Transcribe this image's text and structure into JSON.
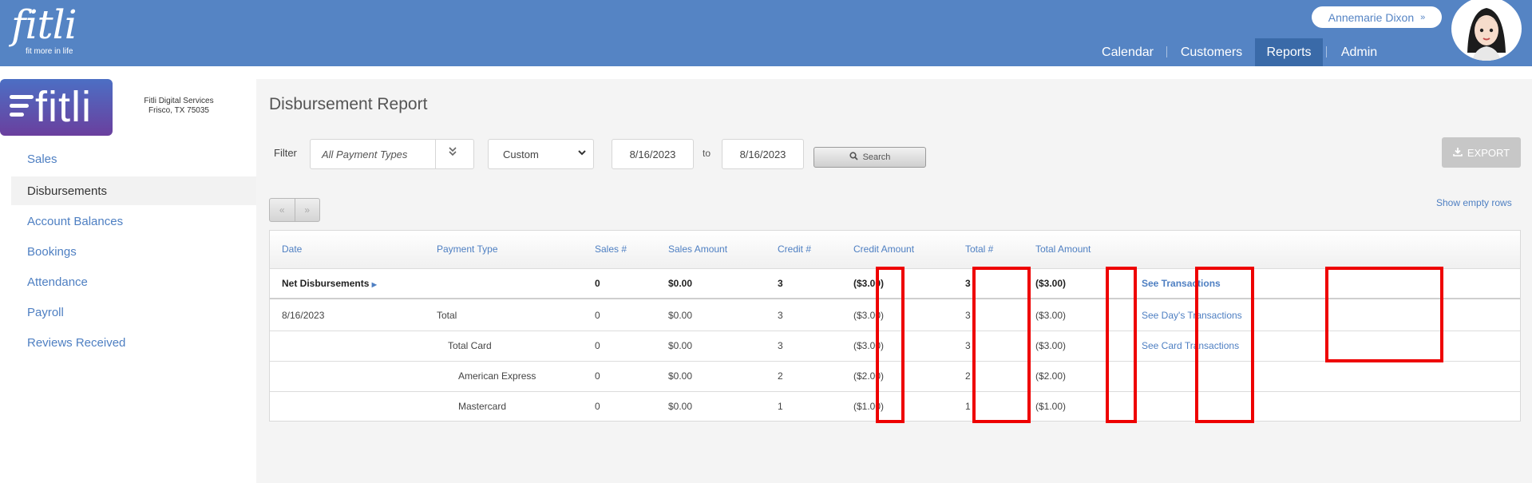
{
  "brand": {
    "name": "fitli",
    "tagline": "fit more in life"
  },
  "user": {
    "name": "Annemarie Dixon",
    "chevron": "»"
  },
  "nav": [
    {
      "label": "Calendar",
      "active": false
    },
    {
      "label": "Customers",
      "active": false
    },
    {
      "label": "Reports",
      "active": true
    },
    {
      "label": "Admin",
      "active": false
    }
  ],
  "company": {
    "logo_text": "fitli",
    "name": "Fitli Digital Services",
    "address": "Frisco, TX 75035"
  },
  "sidebar": {
    "items": [
      {
        "label": "Sales",
        "active": false
      },
      {
        "label": "Disbursements",
        "active": true
      },
      {
        "label": "Account Balances",
        "active": false
      },
      {
        "label": "Bookings",
        "active": false
      },
      {
        "label": "Attendance",
        "active": false
      },
      {
        "label": "Payroll",
        "active": false
      },
      {
        "label": "Reviews Received",
        "active": false
      }
    ]
  },
  "report": {
    "title": "Disbursement Report",
    "filter_label": "Filter",
    "payment_type_placeholder": "All Payment Types",
    "range_value": "Custom",
    "date_from": "8/16/2023",
    "to_label": "to",
    "date_to": "8/16/2023",
    "search_label": "Search",
    "export_label": "EXPORT",
    "pager_prev": "«",
    "pager_next": "»",
    "show_empty_rows": "Show empty rows"
  },
  "table": {
    "headers": [
      "Date",
      "Payment Type",
      "Sales #",
      "Sales Amount",
      "Credit #",
      "Credit Amount",
      "Total #",
      "Total Amount"
    ],
    "rows": [
      {
        "label": "Net Disbursements",
        "date": "",
        "type": "",
        "sales_n": "0",
        "sales_amt": "$0.00",
        "credit_n": "3",
        "credit_amt": "($3.00)",
        "total_n": "3",
        "total_amt": "($3.00)",
        "link": "See Transactions"
      },
      {
        "label": "",
        "date": "8/16/2023",
        "type": "Total",
        "sales_n": "0",
        "sales_amt": "$0.00",
        "credit_n": "3",
        "credit_amt": "($3.00)",
        "total_n": "3",
        "total_amt": "($3.00)",
        "link": "See Day's Transactions"
      },
      {
        "label": "",
        "date": "",
        "type": "Total Card",
        "sales_n": "0",
        "sales_amt": "$0.00",
        "credit_n": "3",
        "credit_amt": "($3.00)",
        "total_n": "3",
        "total_amt": "($3.00)",
        "link": "See Card Transactions"
      },
      {
        "label": "",
        "date": "",
        "type": "American Express",
        "sales_n": "0",
        "sales_amt": "$0.00",
        "credit_n": "2",
        "credit_amt": "($2.00)",
        "total_n": "2",
        "total_amt": "($2.00)",
        "link": ""
      },
      {
        "label": "",
        "date": "",
        "type": "Mastercard",
        "sales_n": "0",
        "sales_amt": "$0.00",
        "credit_n": "1",
        "credit_amt": "($1.00)",
        "total_n": "1",
        "total_amt": "($1.00)",
        "link": ""
      }
    ]
  },
  "colors": {
    "header_bg": "#5584c4",
    "nav_active": "#3a6aa8",
    "link": "#4e7fc2",
    "highlight": "#ee0000"
  },
  "icons": {
    "search": "search-icon",
    "download": "download-icon",
    "dropdown": "chevron-down-icon",
    "double_chevron": "double-chevron-down-icon"
  }
}
